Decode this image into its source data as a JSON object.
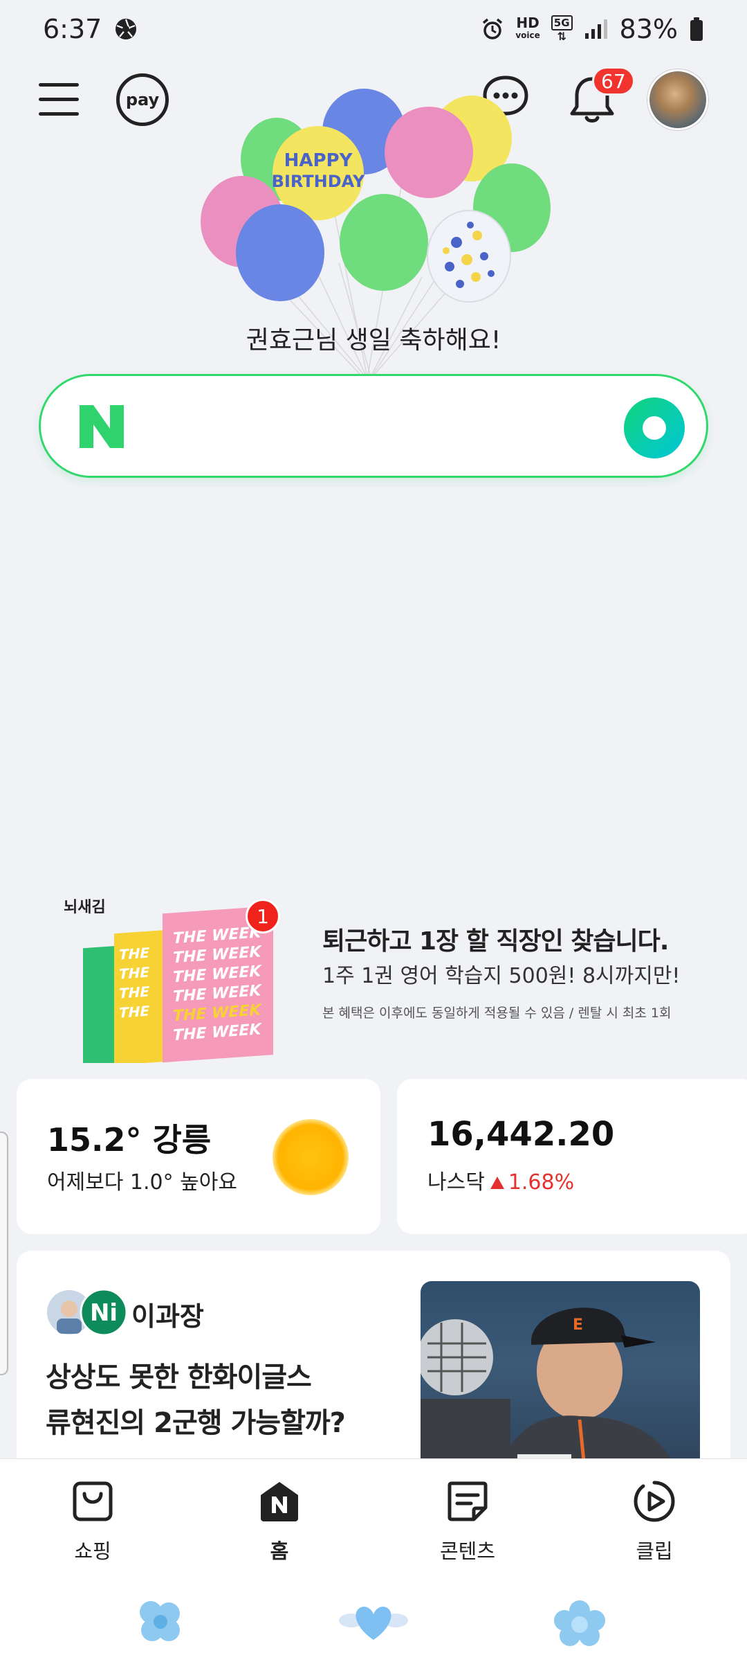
{
  "status_bar": {
    "time": "6:37",
    "hd_label": "HD",
    "voice_label": "voice",
    "network": "5G",
    "battery": "83%"
  },
  "header": {
    "pay_label": "pay",
    "notification_count": "67"
  },
  "birthday": {
    "message": "권효근님 생일 축하해요!",
    "balloon_text_1": "HAPPY",
    "balloon_text_2": "BIRTHDAY"
  },
  "search": {
    "logo_letter": "N"
  },
  "ad": {
    "brand": "뇌새김",
    "badge": "1",
    "title": "퇴근하고 1장 할 직장인 찾습니다.",
    "subtitle": "1주 1권 영어 학습지 500원! 8시까지만!",
    "note": "본 혜택은 이후에도 동일하게 적용될 수 있음 / 렌탈 시 최초 1회"
  },
  "weather": {
    "temp_location": "15.2° 강릉",
    "comparison": "어제보다 1.0° 높아요"
  },
  "stock": {
    "value": "16,442.20",
    "index_name": "나스닥",
    "change": "1.68%",
    "change_color": "#e5312e"
  },
  "news": {
    "author": "이과장",
    "title_line1": "상상도 못한 한화이글스",
    "title_line2": "류현진의 2군행 가능할까?"
  },
  "bottom_nav": {
    "items": [
      {
        "label": "쇼핑",
        "icon": "shopping-bag-icon"
      },
      {
        "label": "홈",
        "icon": "home-n-icon"
      },
      {
        "label": "콘텐츠",
        "icon": "contents-icon"
      },
      {
        "label": "클립",
        "icon": "clip-play-icon"
      }
    ]
  },
  "colors": {
    "brand_green": "#03c75a",
    "badge_red": "#f2342e",
    "background": "#f1f2f6"
  }
}
